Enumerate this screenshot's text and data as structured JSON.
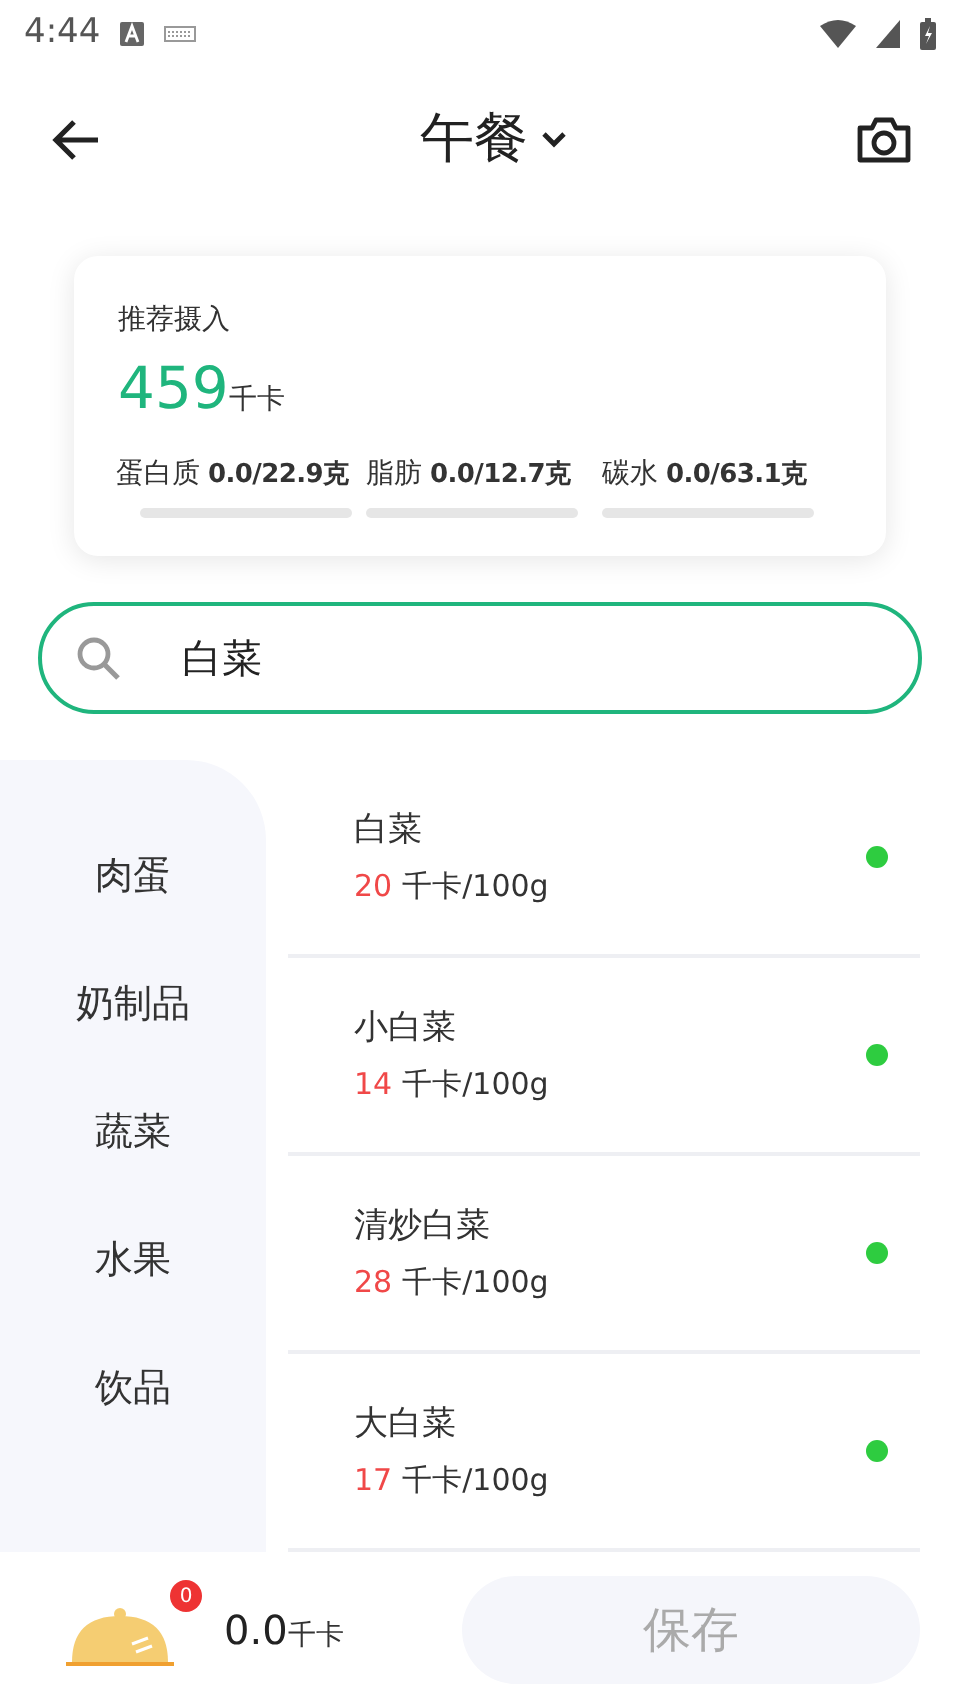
{
  "status_bar": {
    "time": "4:44"
  },
  "header": {
    "title": "午餐"
  },
  "summary": {
    "label": "推荐摄入",
    "calories": "459",
    "calories_unit": "千卡",
    "nutrients": [
      {
        "name": "蛋白质",
        "value": "0.0/22.9克",
        "level": 0
      },
      {
        "name": "脂肪",
        "value": "0.0/12.7克",
        "level": 0
      },
      {
        "name": "碳水",
        "value": "0.0/63.1克",
        "level": 0
      }
    ]
  },
  "search": {
    "value": "白菜"
  },
  "categories": [
    {
      "label": "肉蛋"
    },
    {
      "label": "奶制品"
    },
    {
      "label": "蔬菜"
    },
    {
      "label": "水果"
    },
    {
      "label": "饮品"
    }
  ],
  "foods": [
    {
      "name": "白菜",
      "calories": "20",
      "unit": "千卡/100g",
      "color": "#2ecc40"
    },
    {
      "name": "小白菜",
      "calories": "14",
      "unit": "千卡/100g",
      "color": "#2ecc40"
    },
    {
      "name": "清炒白菜",
      "calories": "28",
      "unit": "千卡/100g",
      "color": "#2ecc40"
    },
    {
      "name": "大白菜",
      "calories": "17",
      "unit": "千卡/100g",
      "color": "#2ecc40"
    }
  ],
  "bottom_bar": {
    "count": "0",
    "total": "0.0",
    "total_unit": "千卡",
    "save_button": "保存"
  }
}
